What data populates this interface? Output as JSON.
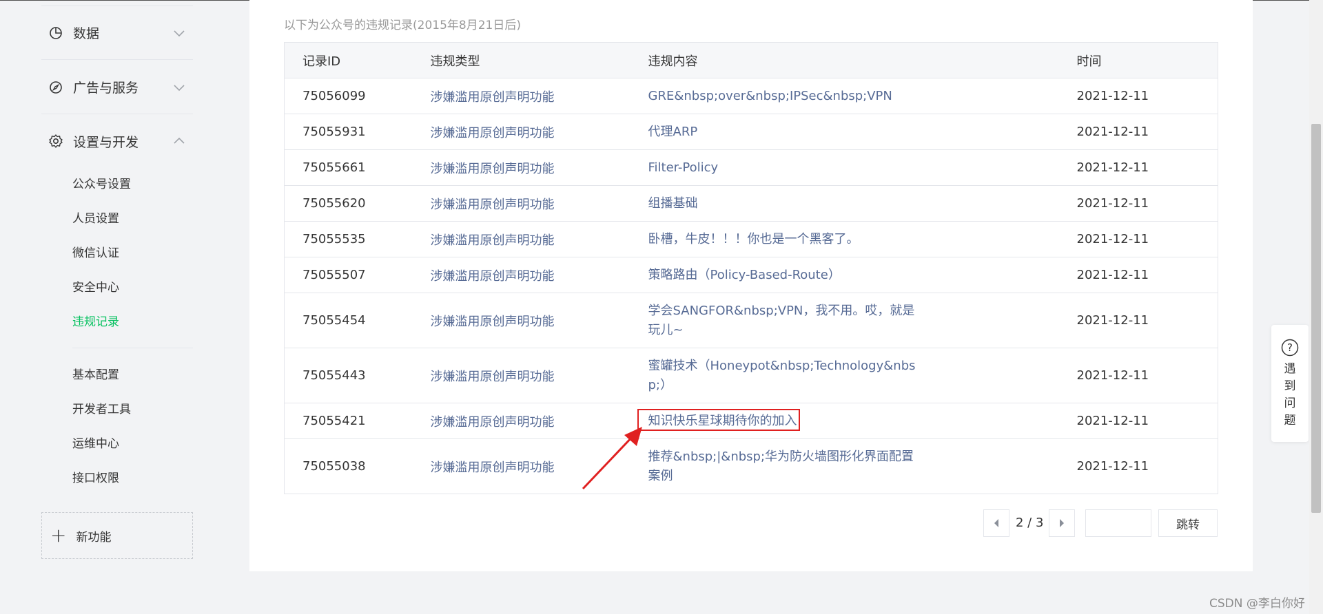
{
  "sidebar": {
    "groups": [
      {
        "label": "数据",
        "icon": "pie-chart-icon"
      },
      {
        "label": "广告与服务",
        "icon": "compass-icon"
      },
      {
        "label": "设置与开发",
        "icon": "gear-icon"
      }
    ],
    "settings_items": [
      "公众号设置",
      "人员设置",
      "微信认证",
      "安全中心",
      "违规记录"
    ],
    "dev_items": [
      "基本配置",
      "开发者工具",
      "运维中心",
      "接口权限"
    ],
    "active_item": "违规记录",
    "new_feature_label": "新功能"
  },
  "main": {
    "intro": "以下为公众号的违规记录(2015年8月21日后)",
    "table": {
      "headers": [
        "记录ID",
        "违规类型",
        "违规内容",
        "时间"
      ],
      "rows": [
        {
          "id": "75056099",
          "type": "涉嫌滥用原创声明功能",
          "content": "GRE&nbsp;over&nbsp;IPSec&nbsp;VPN",
          "time": "2021-12-11"
        },
        {
          "id": "75055931",
          "type": "涉嫌滥用原创声明功能",
          "content": "代理ARP",
          "time": "2021-12-11"
        },
        {
          "id": "75055661",
          "type": "涉嫌滥用原创声明功能",
          "content": "Filter-Policy",
          "time": "2021-12-11"
        },
        {
          "id": "75055620",
          "type": "涉嫌滥用原创声明功能",
          "content": "组播基础",
          "time": "2021-12-11"
        },
        {
          "id": "75055535",
          "type": "涉嫌滥用原创声明功能",
          "content": "卧槽，牛皮！！！你也是一个黑客了。",
          "time": "2021-12-11"
        },
        {
          "id": "75055507",
          "type": "涉嫌滥用原创声明功能",
          "content": "策略路由（Policy-Based-Route）",
          "time": "2021-12-11"
        },
        {
          "id": "75055454",
          "type": "涉嫌滥用原创声明功能",
          "content": "学会SANGFOR&nbsp;VPN，我不用。哎，就是玩儿~",
          "time": "2021-12-11"
        },
        {
          "id": "75055443",
          "type": "涉嫌滥用原创声明功能",
          "content": "蜜罐技术（Honeypot&nbsp;Technology&nbsp;）",
          "time": "2021-12-11"
        },
        {
          "id": "75055421",
          "type": "涉嫌滥用原创声明功能",
          "content": "知识快乐星球期待你的加入",
          "time": "2021-12-11"
        },
        {
          "id": "75055038",
          "type": "涉嫌滥用原创声明功能",
          "content": "推荐&nbsp;|&nbsp;华为防火墙图形化界面配置案例",
          "time": "2021-12-11"
        }
      ]
    },
    "pagination": {
      "text": "2 / 3",
      "jump_label": "跳转",
      "input_value": ""
    }
  },
  "help": {
    "text": "遇到问题"
  },
  "watermark": "CSDN @李白你好",
  "colors": {
    "accent": "#07c160",
    "link": "#576b95",
    "highlight": "#e02020"
  }
}
